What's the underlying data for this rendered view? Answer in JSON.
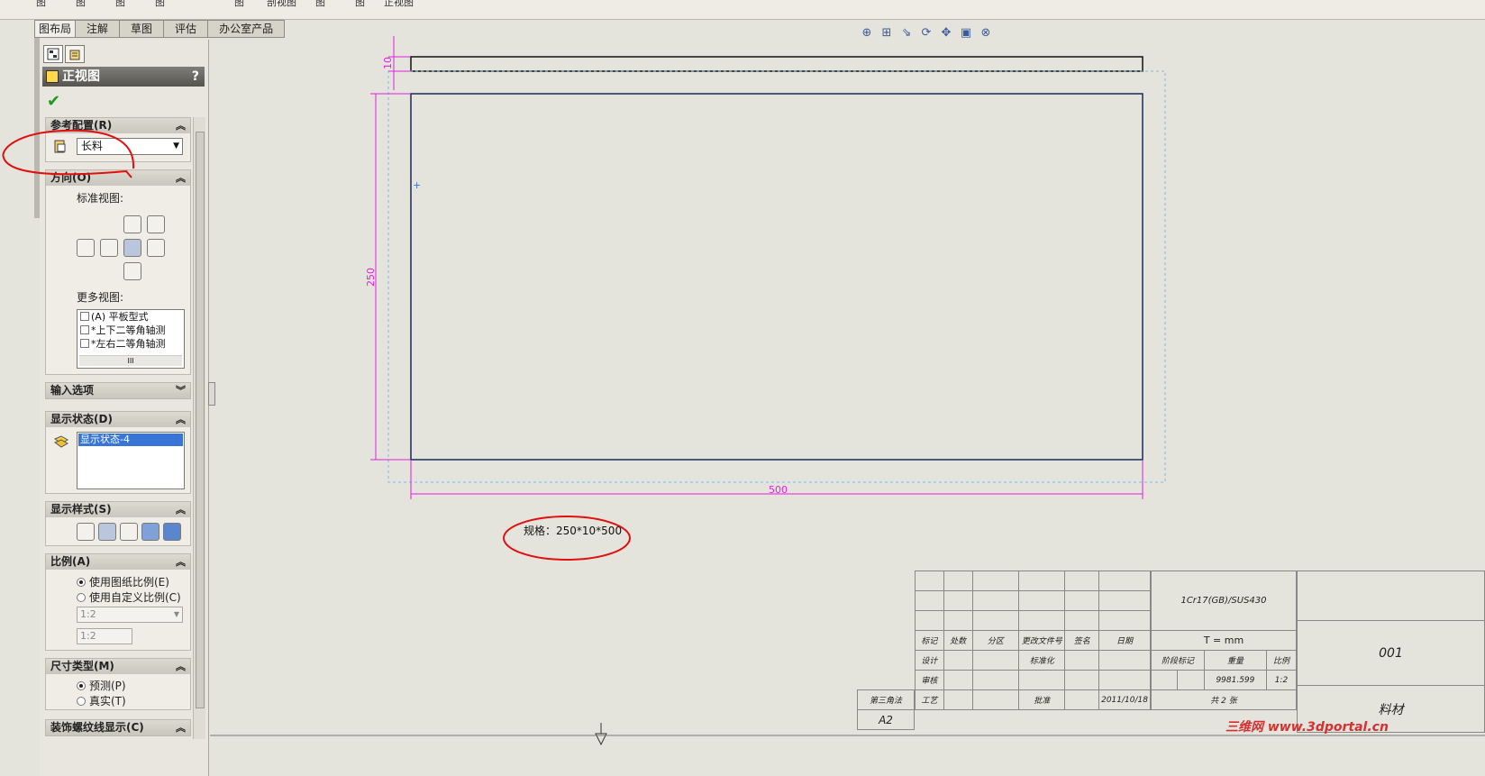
{
  "top_menu": [
    "图",
    "图",
    "图",
    "图",
    "图",
    "剖视图",
    "图",
    "图",
    "正视图"
  ],
  "tabs": [
    {
      "label": "图布局",
      "active": true
    },
    {
      "label": "注解",
      "active": false
    },
    {
      "label": "草图",
      "active": false
    },
    {
      "label": "评估",
      "active": false
    },
    {
      "label": "办公室产品",
      "active": false
    }
  ],
  "panel": {
    "title": "正视图",
    "help": "?",
    "ok_symbol": "✔",
    "groups": {
      "reference_config": {
        "label": "参考配置(R)",
        "value": "长料"
      },
      "orientation": {
        "label": "方向(O)",
        "standard_views_label": "标准视图:",
        "more_views_label": "更多视图:",
        "more_views": [
          "(A) 平板型式",
          "*上下二等角轴测",
          "*左右二等角轴测"
        ],
        "scroll_label": "III"
      },
      "import_options": {
        "label": "输入选项"
      },
      "display_state": {
        "label": "显示状态(D)",
        "items": [
          "显示状态-4"
        ]
      },
      "display_style": {
        "label": "显示样式(S)"
      },
      "scale": {
        "label": "比例(A)",
        "option_sheet": "使用图纸比例(E)",
        "option_custom": "使用自定义比例(C)",
        "custom_select": "1:2",
        "custom_text": "1:2"
      },
      "dimension_type": {
        "label": "尺寸类型(M)",
        "option_projected": "预测(P)",
        "option_true": "真实(T)"
      },
      "cosmetic_thread": {
        "label": "装饰螺纹线显示(C)"
      }
    }
  },
  "drawing": {
    "dim_thickness": "10",
    "dim_height": "250",
    "dim_width": "500",
    "spec_note": "规格：250*10*500"
  },
  "title_block": {
    "material": "1Cr17(GB)/SUS430",
    "thickness": "T = mm",
    "drawing_no": "001",
    "part_name": "料材",
    "headers": [
      "标记",
      "处数",
      "分区",
      "更改文件号",
      "签名",
      "日期"
    ],
    "design": "设计",
    "standardize": "标准化",
    "stage_mark": "阶段标记",
    "weight": "重量",
    "scale_label": "比例",
    "scale_value": "1:2",
    "weight_value": "9981.599",
    "check": "审核",
    "process": "工艺",
    "approve": "批准",
    "projection": "第三角法",
    "sheet_size": "A2",
    "date": "2011/10/18",
    "sheets": "共 2 张"
  },
  "watermark": "三维网 www.3dportal.cn",
  "colors": {
    "dimension": "#e020e0",
    "part_outline": "#1a2a5a",
    "annotation": "#e01010",
    "selection": "#3875d7"
  }
}
